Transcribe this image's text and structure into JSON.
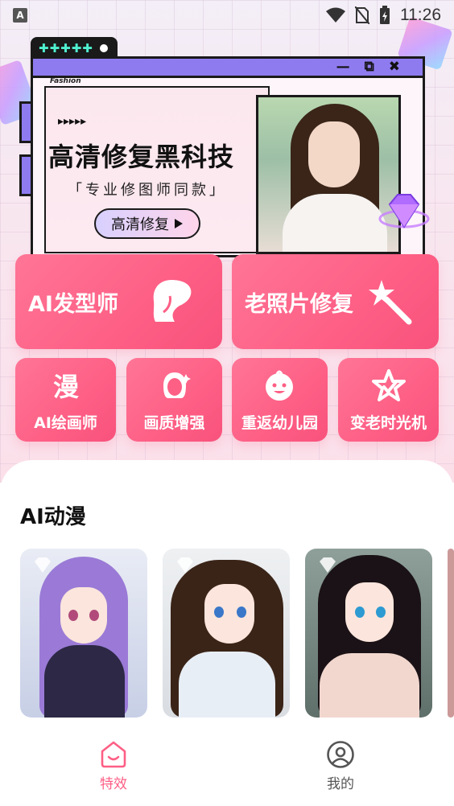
{
  "status_bar": {
    "app_icon_letter": "A",
    "time": "11:26"
  },
  "banner": {
    "corner_label": "Fashion",
    "arrows": "▸▸▸▸▸",
    "headline": "高清修复黑科技",
    "subtitle": "「专业修图师同款」",
    "cta_label": "高清修复",
    "tab_symbols": "✚✚✚✚✚"
  },
  "features_large": [
    {
      "label": "AI发型师",
      "icon": "hair-silhouette-icon"
    },
    {
      "label": "老照片修复",
      "icon": "magic-wand-icon"
    }
  ],
  "features_small": [
    {
      "label": "AI绘画师",
      "icon": "manga-glyph-icon"
    },
    {
      "label": "画质增强",
      "icon": "sparkle-face-icon"
    },
    {
      "label": "重返幼儿园",
      "icon": "baby-face-icon"
    },
    {
      "label": "变老时光机",
      "icon": "star-icon"
    }
  ],
  "section": {
    "title": "AI动漫"
  },
  "anime_cards": [
    {
      "name": "anime-card-purple-hair"
    },
    {
      "name": "anime-card-brown-hair"
    },
    {
      "name": "anime-card-black-hair"
    }
  ],
  "bottom_nav": {
    "items": [
      {
        "label": "特效",
        "active": true,
        "icon": "effects-icon"
      },
      {
        "label": "我的",
        "active": false,
        "icon": "profile-icon"
      }
    ]
  },
  "colors": {
    "accent": "#fe5f85",
    "nav_active": "#fe5f85",
    "nav_inactive": "#555555"
  }
}
